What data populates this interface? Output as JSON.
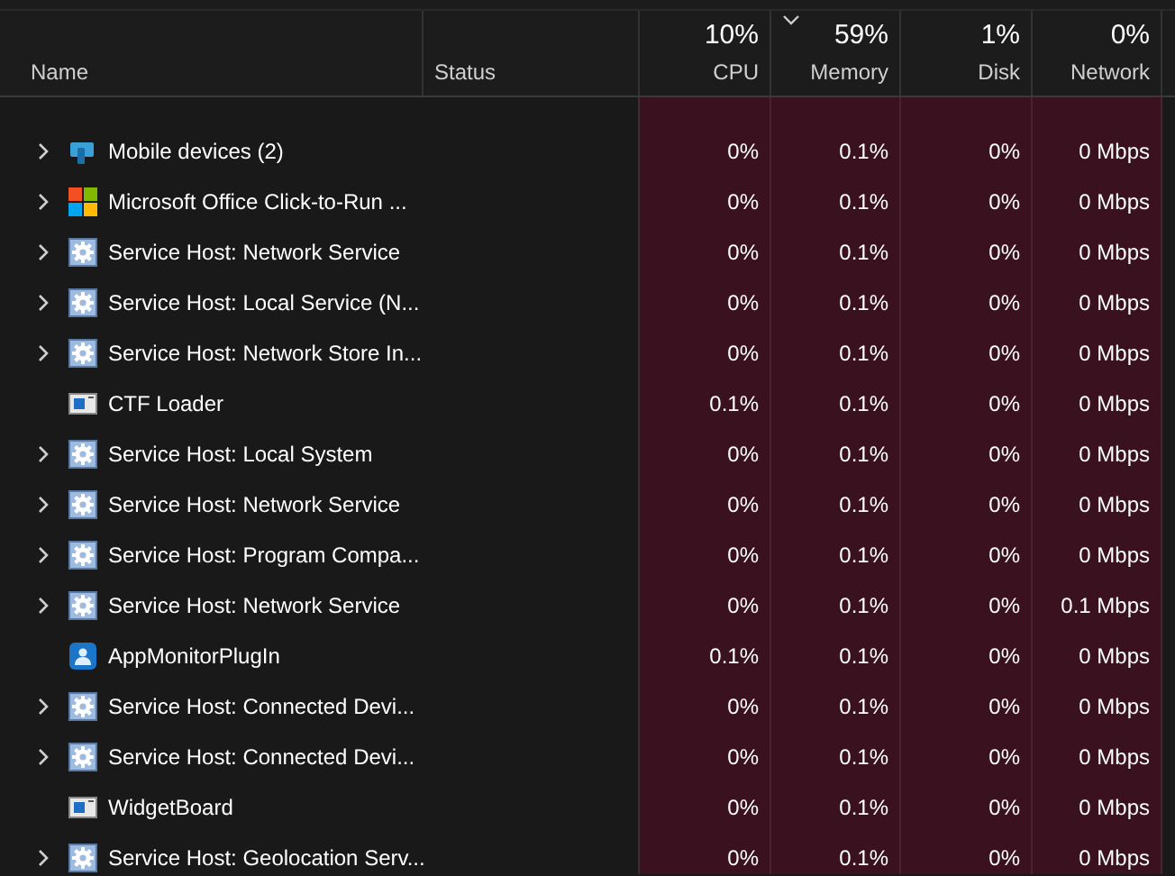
{
  "columns": [
    {
      "label": "Name"
    },
    {
      "label": "Status"
    },
    {
      "label": "CPU",
      "total": "10%",
      "sorted": false
    },
    {
      "label": "Memory",
      "total": "59%",
      "sorted": true
    },
    {
      "label": "Disk",
      "total": "1%",
      "sorted": false
    },
    {
      "label": "Network",
      "total": "0%",
      "sorted": false
    }
  ],
  "rows": [
    {
      "name": "Mobile devices (2)",
      "kind": "mobile",
      "expandable": true,
      "cpu": "0%",
      "memory": "0.1%",
      "disk": "0%",
      "network": "0 Mbps"
    },
    {
      "name": "Microsoft Office Click-to-Run ...",
      "kind": "office",
      "expandable": true,
      "cpu": "0%",
      "memory": "0.1%",
      "disk": "0%",
      "network": "0 Mbps"
    },
    {
      "name": "Service Host: Network Service",
      "kind": "service",
      "expandable": true,
      "cpu": "0%",
      "memory": "0.1%",
      "disk": "0%",
      "network": "0 Mbps"
    },
    {
      "name": "Service Host: Local Service (N...",
      "kind": "service",
      "expandable": true,
      "cpu": "0%",
      "memory": "0.1%",
      "disk": "0%",
      "network": "0 Mbps"
    },
    {
      "name": "Service Host: Network Store In...",
      "kind": "service",
      "expandable": true,
      "cpu": "0%",
      "memory": "0.1%",
      "disk": "0%",
      "network": "0 Mbps"
    },
    {
      "name": "CTF Loader",
      "kind": "window",
      "expandable": false,
      "cpu": "0.1%",
      "memory": "0.1%",
      "disk": "0%",
      "network": "0 Mbps"
    },
    {
      "name": "Service Host: Local System",
      "kind": "service",
      "expandable": true,
      "cpu": "0%",
      "memory": "0.1%",
      "disk": "0%",
      "network": "0 Mbps"
    },
    {
      "name": "Service Host: Network Service",
      "kind": "service",
      "expandable": true,
      "cpu": "0%",
      "memory": "0.1%",
      "disk": "0%",
      "network": "0 Mbps"
    },
    {
      "name": "Service Host: Program Compa...",
      "kind": "service",
      "expandable": true,
      "cpu": "0%",
      "memory": "0.1%",
      "disk": "0%",
      "network": "0 Mbps"
    },
    {
      "name": "Service Host: Network Service",
      "kind": "service",
      "expandable": true,
      "cpu": "0%",
      "memory": "0.1%",
      "disk": "0%",
      "network": "0.1 Mbps"
    },
    {
      "name": "AppMonitorPlugIn",
      "kind": "app",
      "expandable": false,
      "cpu": "0.1%",
      "memory": "0.1%",
      "disk": "0%",
      "network": "0 Mbps"
    },
    {
      "name": "Service Host: Connected Devi...",
      "kind": "service",
      "expandable": true,
      "cpu": "0%",
      "memory": "0.1%",
      "disk": "0%",
      "network": "0 Mbps"
    },
    {
      "name": "Service Host: Connected Devi...",
      "kind": "service",
      "expandable": true,
      "cpu": "0%",
      "memory": "0.1%",
      "disk": "0%",
      "network": "0 Mbps"
    },
    {
      "name": "WidgetBoard",
      "kind": "window",
      "expandable": false,
      "cpu": "0%",
      "memory": "0.1%",
      "disk": "0%",
      "network": "0 Mbps"
    },
    {
      "name": "Service Host: Geolocation Serv...",
      "kind": "service",
      "expandable": true,
      "cpu": "0%",
      "memory": "0.1%",
      "disk": "0%",
      "network": "0 Mbps"
    }
  ]
}
